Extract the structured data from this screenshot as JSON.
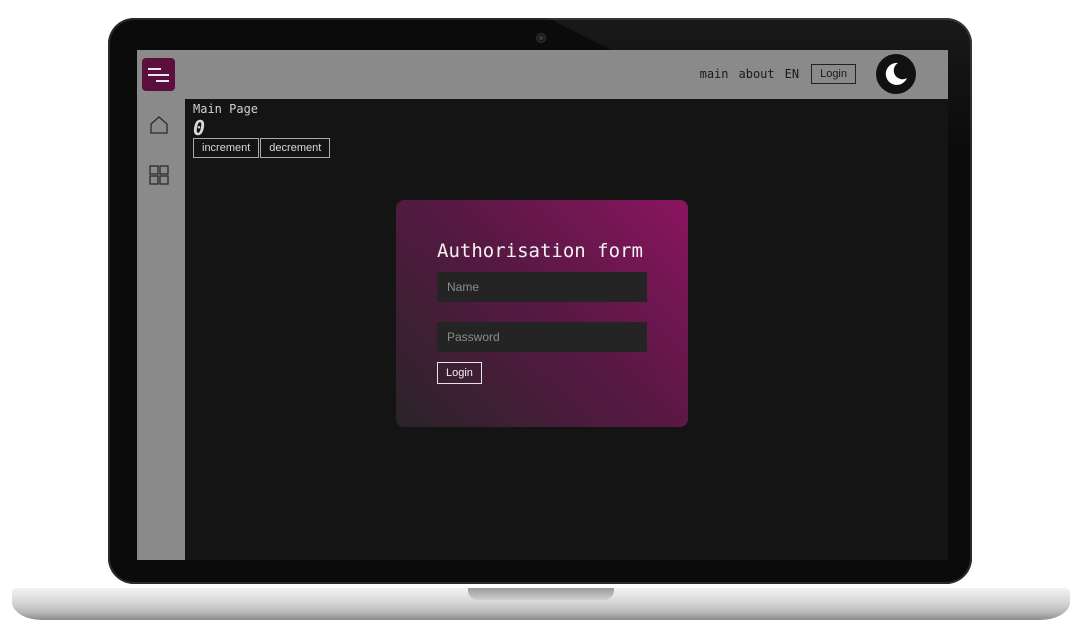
{
  "navbar": {
    "links": [
      {
        "label": "main"
      },
      {
        "label": "about"
      }
    ],
    "language": "EN",
    "login_label": "Login",
    "theme_icon": "moon-icon"
  },
  "sidebar": {
    "menu_icon": "menu-toggle-icon",
    "items": [
      {
        "icon": "home-icon"
      },
      {
        "icon": "grid-icon"
      }
    ]
  },
  "main": {
    "title": "Main Page",
    "counter": "0",
    "increment_label": "increment",
    "decrement_label": "decrement"
  },
  "auth_modal": {
    "title": "Authorisation form",
    "name_placeholder": "Name",
    "password_placeholder": "Password",
    "login_label": "Login"
  },
  "colors": {
    "navbar_bg": "#8a8a8a",
    "screen_bg": "#141414",
    "accent": "#8a155f"
  }
}
